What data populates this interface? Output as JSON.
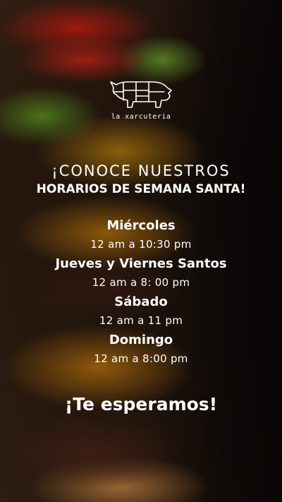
{
  "brand": {
    "logo_icon": "pig-butcher-chart-icon",
    "name": "la xarcuteria"
  },
  "headline": {
    "line1": "¡CONOCE NUESTROS",
    "line2": "HORARIOS DE SEMANA SANTA!"
  },
  "schedule": [
    {
      "day": "Miércoles",
      "hours": "12 am a 10:30 pm"
    },
    {
      "day": "Jueves y Viernes Santos",
      "hours": "12 am a 8: 00 pm"
    },
    {
      "day": "Sábado",
      "hours": "12 am a 11 pm"
    },
    {
      "day": "Domingo",
      "hours": "12 am a 8:00 pm"
    }
  ],
  "closing": "¡Te esperamos!",
  "colors": {
    "text": "#ffffff",
    "background": "#120d0a"
  }
}
